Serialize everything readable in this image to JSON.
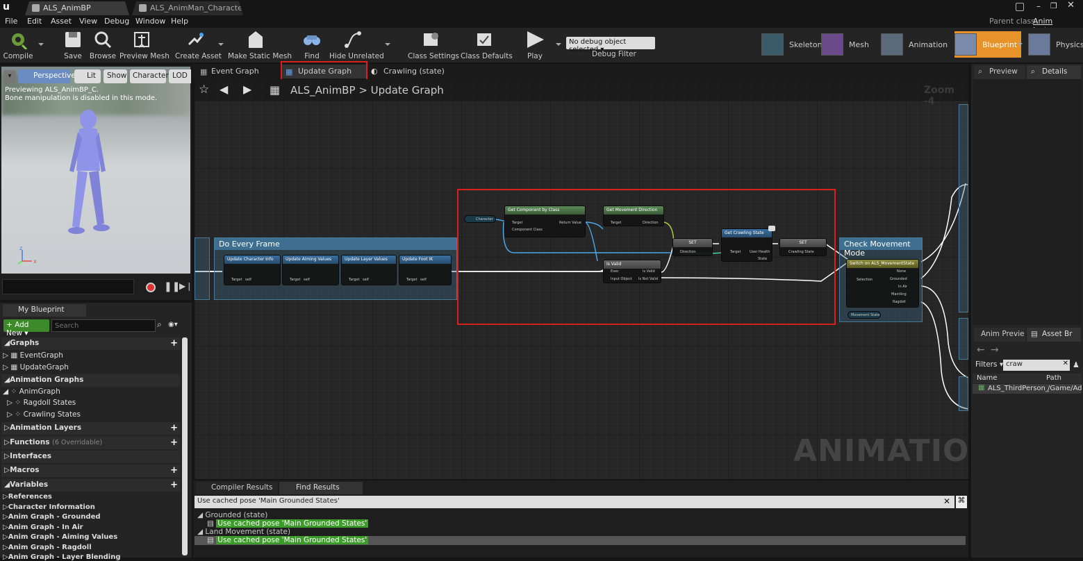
{
  "window_tabs": [
    {
      "label": "ALS_AnimBP"
    },
    {
      "label": "ALS_AnimMan_Character"
    }
  ],
  "parent_class_label": "Parent class:",
  "parent_class_value": "Anim Instance",
  "menu": [
    "File",
    "Edit",
    "Asset",
    "View",
    "Debug",
    "Window",
    "Help"
  ],
  "toolbar": {
    "compile": "Compile",
    "save": "Save",
    "browse": "Browse",
    "preview_mesh": "Preview Mesh",
    "create_asset": "Create Asset",
    "make_static_mesh": "Make Static Mesh",
    "find": "Find",
    "hide_unrelated": "Hide Unrelated",
    "class_settings": "Class Settings",
    "class_defaults": "Class Defaults",
    "play": "Play",
    "debug_select": "No debug object selected",
    "debug_filter": "Debug Filter"
  },
  "modes": [
    "Skeleton",
    "Mesh",
    "Animation",
    "Blueprint",
    "Physics"
  ],
  "viewport": {
    "buttons": [
      "Perspective",
      "Lit",
      "Show",
      "Character",
      "LOD"
    ],
    "info_line1": "Previewing ALS_AnimBP_C.",
    "info_line2": "Bone manipulation is disabled in this mode."
  },
  "graph_tabs": [
    "Event Graph",
    "Update Graph",
    "Crawling (state)"
  ],
  "breadcrumb": {
    "root": "ALS_AnimBP",
    "sep": ">",
    "current": "Update Graph"
  },
  "zoom": "Zoom -4",
  "watermark": "ANIMATION",
  "comment_title": "Do Every Frame",
  "check_title": "Check Movement Mode",
  "nodes": {
    "update_char": "Update Character Info",
    "update_aim": "Update Aiming Values",
    "update_layer": "Update Layer Values",
    "update_foot": "Update Foot IK",
    "get_component": "Get Component by Class",
    "get_move_dir": "Get Movement Direction",
    "is_valid": "Is Valid",
    "set1": "SET",
    "get_crawl": "Get Crawling State",
    "set2": "SET",
    "switch": "Switch on ALS_MovementState",
    "character_var": "Character",
    "movement_state": "Movement State",
    "pin_target": "Target",
    "pin_self": "self",
    "pin_return": "Return Value",
    "pin_component_class": "Component Class",
    "pin_direction": "Direction",
    "pin_exec": "Exec",
    "pin_is_valid": "Is Valid",
    "pin_input_object": "Input Object",
    "pin_is_not_valid": "Is Not Valid",
    "pin_user_health": "User Health",
    "pin_state": "State",
    "pin_crawling_state": "Crawling State",
    "pin_selection": "Selection",
    "sw_none": "None",
    "sw_grounded": "Grounded",
    "sw_in_air": "In Air",
    "sw_mantling": "Mantling",
    "sw_ragdoll": "Ragdoll"
  },
  "my_blueprint": {
    "tab": "My Blueprint",
    "add_new": "Add New",
    "search_placeholder": "Search",
    "graphs": "Graphs",
    "event_graph": "EventGraph",
    "update_graph": "UpdateGraph",
    "animation_graphs": "Animation Graphs",
    "anim_graph": "AnimGraph",
    "ragdoll_states": "Ragdoll States",
    "crawling_states": "Crawling States",
    "animation_layers": "Animation Layers",
    "functions": "Functions",
    "functions_note": "(6 Overridable)",
    "interfaces": "Interfaces",
    "macros": "Macros",
    "variables": "Variables",
    "var_items": [
      "References",
      "Character Information",
      "Anim Graph - Grounded",
      "Anim Graph - In Air",
      "Anim Graph - Aiming Values",
      "Anim Graph - Ragdoll",
      "Anim Graph - Layer Blending"
    ]
  },
  "bottom": {
    "tabs": [
      "Compiler Results",
      "Find Results"
    ],
    "search_value": "Use cached pose 'Main Grounded States'",
    "results": [
      {
        "group": "Grounded (state)",
        "item": "Use cached pose 'Main Grounded States'"
      },
      {
        "group": "Land Movement (state)",
        "item": "Use cached pose 'Main Grounded States'"
      }
    ]
  },
  "right": {
    "tabs": [
      "Preview",
      "Details"
    ],
    "bottom_tabs": [
      "Anim Previe",
      "Asset Br"
    ],
    "filters": "Filters",
    "filter_value": "craw",
    "col_name": "Name",
    "col_path": "Path",
    "row_name": "ALS_ThirdPerson_",
    "row_path": "/Game/Ad"
  }
}
